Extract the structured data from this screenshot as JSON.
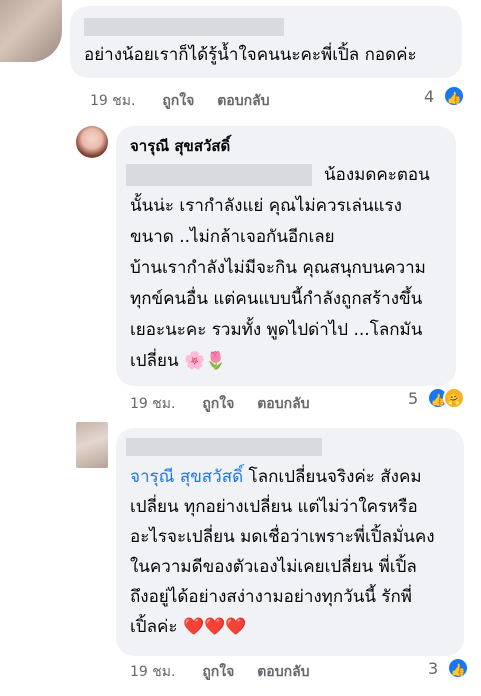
{
  "comments": [
    {
      "author": "",
      "text": "อย่างน้อยเราก็ได้รู้น้ำใจคนนะคะพี่เปิ้ล กอดค่ะ",
      "time": "19 ชม.",
      "like_label": "ถูกใจ",
      "reply_label": "ตอบกลับ",
      "reactions_count": "4",
      "reaction_icons": [
        "like-icon"
      ]
    },
    {
      "author": "จารุณี สุขสวัสดิ์",
      "lines": [
        "น้องมดคะตอน",
        "นั้นน่ะ เรากำลังแย่ คุณไม่ควรเล่นแรง",
        "ขนาด ..ไม่กล้าเจอกันอีกเลย",
        "บ้านเรากำลังไม่มีจะกิน คุณสนุกบนความ",
        "ทุกข์คนอื่น แต่คนแบบนี้กำลังถูกสร้างขึ้น",
        "เยอะนะคะ รวมทั้ง พูดไปด่าไป ...โลกมัน",
        "เปลี่ยน"
      ],
      "emoji": "🌸🌷",
      "time": "19 ชม.",
      "like_label": "ถูกใจ",
      "reply_label": "ตอบกลับ",
      "reactions_count": "5",
      "reaction_icons": [
        "like-icon",
        "care-icon"
      ]
    },
    {
      "author": "",
      "mention": "จารุณี สุขสวัสดิ์",
      "lines": [
        " โลกเปลี่ยนจริงค่ะ สังคม",
        "เปลี่ยน ทุกอย่างเปลี่ยน แต่ไม่ว่าใครหรือ",
        "อะไรจะเปลี่ยน มดเชื่อว่าเพราะพี่เปิ้ลมั่นคง",
        "ในความดีของตัวเองไม่เคยเปลี่ยน พี่เปิ้ล",
        "ถึงอยู่ได้อย่างสง่างามอย่างทุกวันนี้ รักพี่",
        "เปิ้ลค่ะ"
      ],
      "emoji": "❤️❤️❤️",
      "time": "19 ชม.",
      "like_label": "ถูกใจ",
      "reply_label": "ตอบกลับ",
      "reactions_count": "3",
      "reaction_icons": [
        "like-icon"
      ]
    }
  ],
  "colors": {
    "bubble": "#f0f2f5",
    "link": "#1877f2",
    "meta": "#65676b"
  }
}
